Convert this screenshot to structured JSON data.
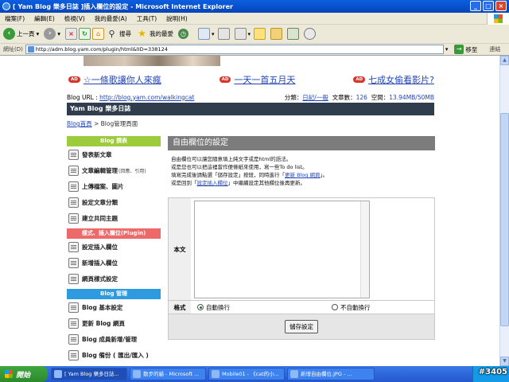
{
  "window": {
    "title": "[ Yam Blog 樂多日誌 ]插入欄位的設定 - Microsoft Internet Explorer",
    "min": "_",
    "max": "□",
    "close": "×"
  },
  "menu": [
    "檔案(F)",
    "編輯(E)",
    "檢視(V)",
    "我的最愛(A)",
    "工具(T)",
    "說明(H)"
  ],
  "toolbar": {
    "back": "上一頁",
    "search": "搜尋",
    "favorites": "我的最愛"
  },
  "address": {
    "label": "網址(D)",
    "url": "http://adm.blog.yam.com/plugin/html&lID=338124",
    "go": "移至",
    "links": "連結"
  },
  "ads": [
    {
      "badge": "AD",
      "text": "☆一條歌讓你人來瘋"
    },
    {
      "badge": "AD",
      "text": "一天一首五月天"
    },
    {
      "badge": "AD",
      "text": "七成女偷看影片?"
    }
  ],
  "blog": {
    "url_label": "Blog URL : ",
    "url": "http://blog.yam.com/walkingcat",
    "category_label": "分類：",
    "category": "日記/一般",
    "posts_label": "文章數：",
    "posts": "126",
    "space_label": "空間：",
    "space": "13.94MB/50MB",
    "banner": "Yam Blog 樂多日誌"
  },
  "breadcrumb": {
    "home": "Blog首頁",
    "sep": " > ",
    "current": "Blog管理頁面"
  },
  "sidebar": {
    "sections": [
      {
        "title": "Blog 撰表",
        "color": "#9ccc3c",
        "items": [
          {
            "label": "發表新文章",
            "small": ""
          },
          {
            "label": "文章編輯管理",
            "small": "(回應、引用)"
          },
          {
            "label": "上傳檔案、圖片",
            "small": ""
          },
          {
            "label": "設定文章分類",
            "small": ""
          },
          {
            "label": "建立共同主題",
            "small": ""
          }
        ]
      },
      {
        "title": "樣式、插入欄位(Plugin)",
        "color": "#ee6a6a",
        "items": [
          {
            "label": "設定插入欄位",
            "small": ""
          },
          {
            "label": "新增插入欄位",
            "small": ""
          },
          {
            "label": "網頁樣式設定",
            "small": ""
          }
        ]
      },
      {
        "title": "Blog 管理",
        "color": "#2e9be0",
        "items": [
          {
            "label": "Blog 基本設定",
            "small": ""
          },
          {
            "label": "更新 Blog 網頁",
            "small": ""
          },
          {
            "label": "Blog 成員新增/管理",
            "small": ""
          },
          {
            "label": "Blog 備份 ( 匯出/匯入 )",
            "small": ""
          }
        ]
      }
    ]
  },
  "main": {
    "title": "自由欄位的設定",
    "desc1": "自由欄位可以讓您隨意填上純文字或是html的語法。",
    "desc2": "或是您也可以把這裡當作便條紙來使用，寫一些To do list。",
    "desc3a": "填寫完成後請點選「儲存設定」按鈕，同時進行「",
    "desc3link": "更新 Blog 網頁",
    "desc3b": "」。",
    "desc4a": "或是回到「",
    "desc4link": "設定插入欄位",
    "desc4b": "」中繼續設定其他欄位後再更新。",
    "body_label": "本文",
    "body_value": "",
    "format_label": "格式",
    "format_options": [
      "自動換行",
      "不自動換行"
    ],
    "format_selected": "自動換行",
    "save": "儲存設定"
  },
  "taskbar": {
    "start": "開始",
    "tasks": [
      "[ Yam Blog 樂多日誌...",
      "散步的貓 - Microsoft ...",
      "Mobile01 - 《cat的小...",
      "新增自由欄位.JPG - ..."
    ],
    "watermark": "#3405"
  }
}
